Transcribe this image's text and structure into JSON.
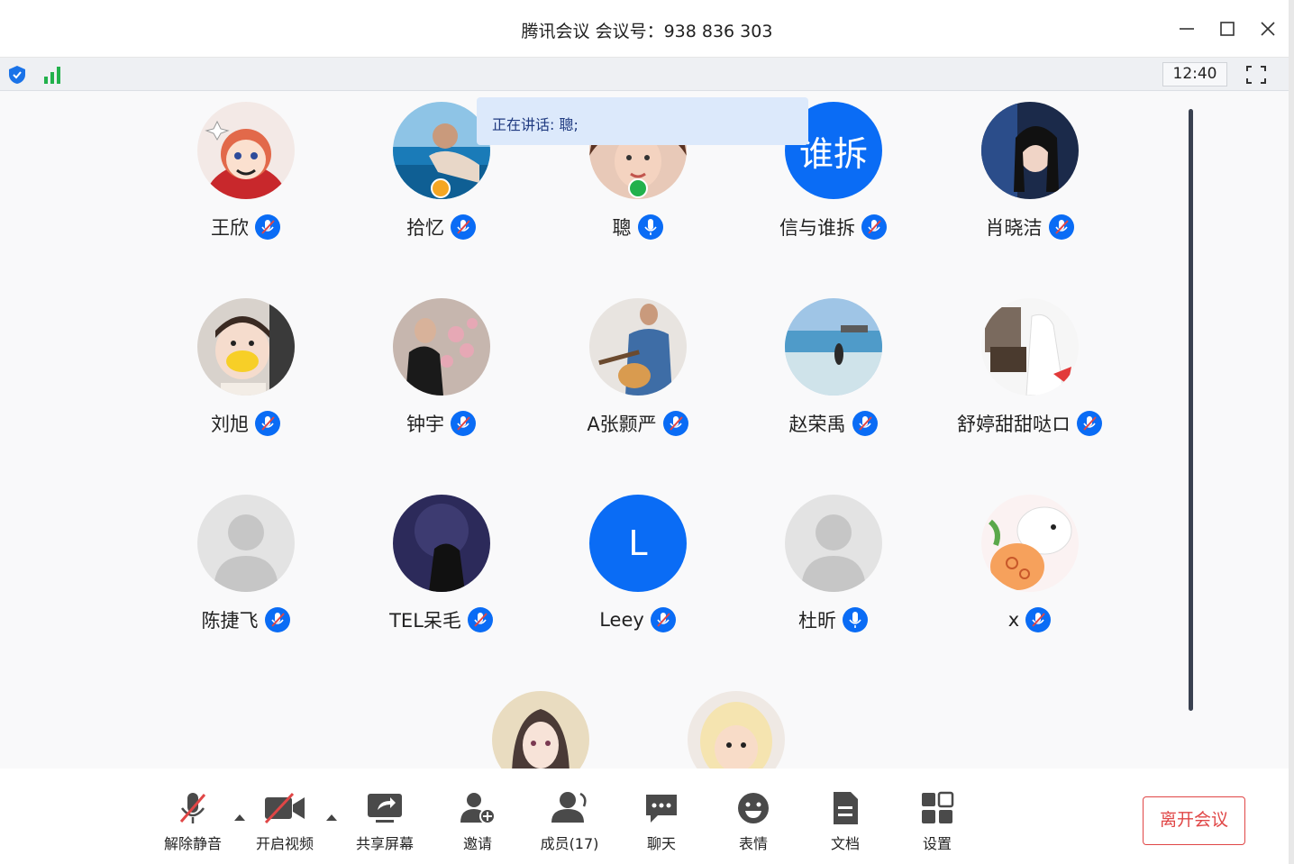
{
  "window": {
    "title": "腾讯会议 会议号：938 836 303"
  },
  "statusbar": {
    "clock": "12:40"
  },
  "speaking": {
    "text": "正在讲话: 聰;"
  },
  "participants": [
    {
      "name": "王欣",
      "mic": "muted",
      "avatar": "anime-avatar"
    },
    {
      "name": "拾忆",
      "mic": "muted",
      "avatar": "photo-pool",
      "badge": "orange"
    },
    {
      "name": "聰",
      "mic": "on",
      "avatar": "photo-woman",
      "badge": "green"
    },
    {
      "name": "信与谁拆",
      "mic": "muted",
      "avatar": "text",
      "avatar_text": "谁拆"
    },
    {
      "name": "肖晓洁",
      "mic": "muted",
      "avatar": "photo-dark"
    },
    {
      "name": "刘旭",
      "mic": "muted",
      "avatar": "photo-child-mask"
    },
    {
      "name": "钟宇",
      "mic": "muted",
      "avatar": "photo-flowers"
    },
    {
      "name": "A张颢严",
      "mic": "muted",
      "avatar": "photo-guitar"
    },
    {
      "name": "赵荣禹",
      "mic": "muted",
      "avatar": "photo-beach"
    },
    {
      "name": "舒婷甜甜哒ロ",
      "mic": "muted",
      "avatar": "photo-room"
    },
    {
      "name": "陈捷飞",
      "mic": "muted",
      "avatar": "default"
    },
    {
      "name": "TEL呆毛",
      "mic": "muted",
      "avatar": "photo-night"
    },
    {
      "name": "Leey",
      "mic": "muted",
      "avatar": "letter",
      "avatar_text": "L"
    },
    {
      "name": "杜昕",
      "mic": "on",
      "avatar": "default"
    },
    {
      "name": "x",
      "mic": "muted",
      "avatar": "cartoon-carrot"
    },
    {
      "name": "",
      "mic": "",
      "avatar": "anime-girl"
    },
    {
      "name": "",
      "mic": "",
      "avatar": "photo-baby"
    }
  ],
  "toolbar": {
    "unmute": "解除静音",
    "start_video": "开启视频",
    "share_screen": "共享屏幕",
    "invite": "邀请",
    "members": "成员(17)",
    "chat": "聊天",
    "emoji": "表情",
    "docs": "文档",
    "settings": "设置",
    "leave": "离开会议"
  },
  "colors": {
    "accent": "#0a6cf5",
    "danger": "#e04646",
    "status_green": "#22b14c"
  }
}
